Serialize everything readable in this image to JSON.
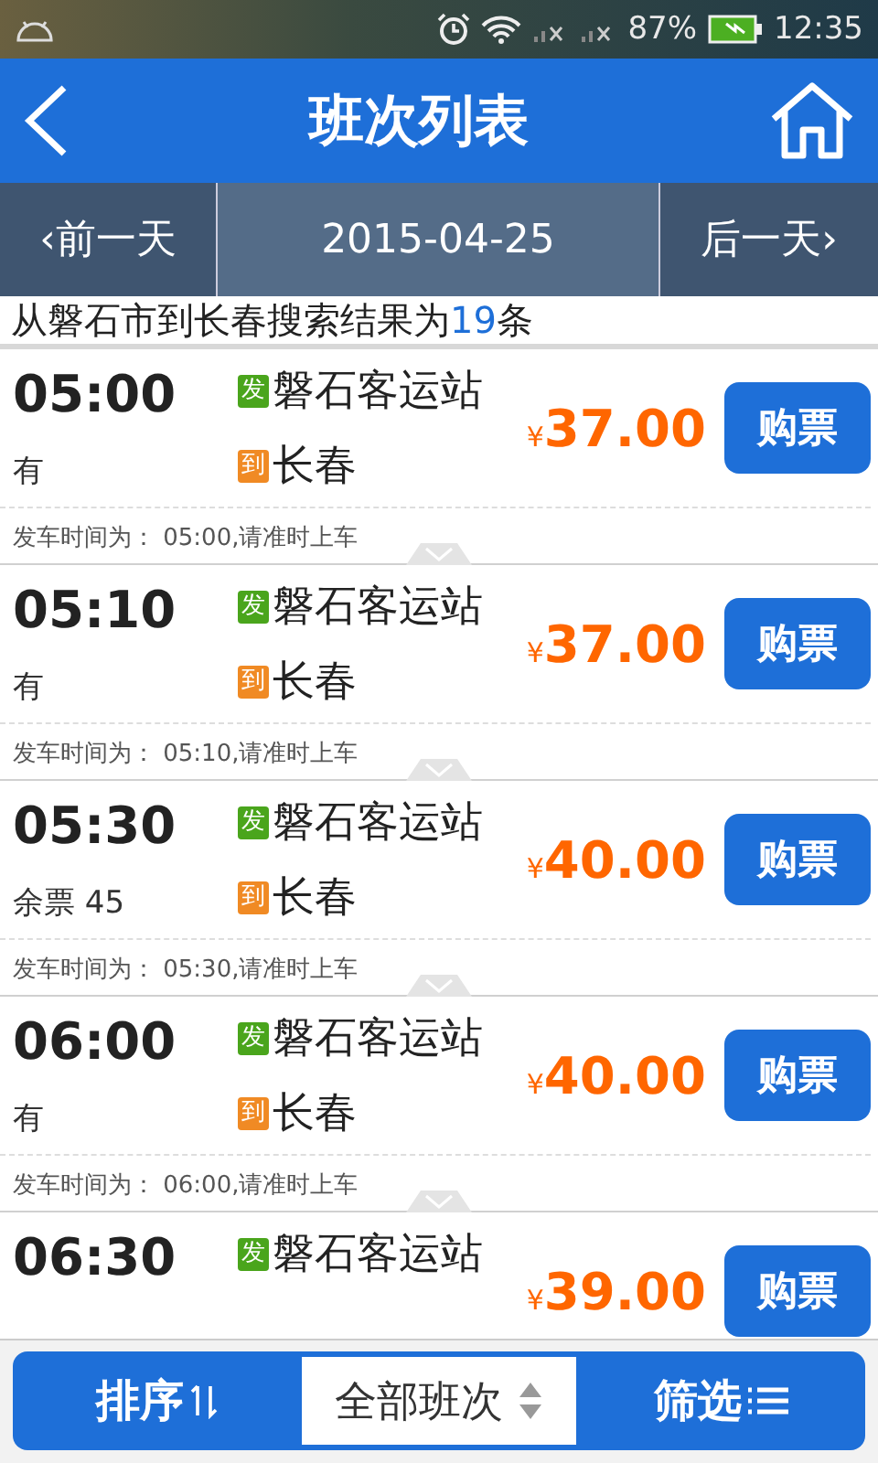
{
  "status_bar": {
    "battery_text": "87%",
    "time": "12:35"
  },
  "header": {
    "title": "班次列表"
  },
  "date_bar": {
    "prev": "‹前一天",
    "date": "2015-04-25",
    "next": "后一天›"
  },
  "summary": {
    "text": "从磐石市到长春搜索结果为",
    "count": "19",
    "suffix": "条"
  },
  "trips": [
    {
      "time": "05:00",
      "availability": "有",
      "from_badge": "发",
      "from": "磐石客运站",
      "to_badge": "到",
      "to": "长春",
      "currency": "¥",
      "price": "37.00",
      "button": "购票",
      "note": "发车时间为： 05:00,请准时上车"
    },
    {
      "time": "05:10",
      "availability": "有",
      "from_badge": "发",
      "from": "磐石客运站",
      "to_badge": "到",
      "to": "长春",
      "currency": "¥",
      "price": "37.00",
      "button": "购票",
      "note": "发车时间为： 05:10,请准时上车"
    },
    {
      "time": "05:30",
      "availability": "余票 45",
      "from_badge": "发",
      "from": "磐石客运站",
      "to_badge": "到",
      "to": "长春",
      "currency": "¥",
      "price": "40.00",
      "button": "购票",
      "note": "发车时间为： 05:30,请准时上车"
    },
    {
      "time": "06:00",
      "availability": "有",
      "from_badge": "发",
      "from": "磐石客运站",
      "to_badge": "到",
      "to": "长春",
      "currency": "¥",
      "price": "40.00",
      "button": "购票",
      "note": "发车时间为： 06:00,请准时上车"
    },
    {
      "time": "06:30",
      "from_badge": "发",
      "from": "磐石客运站",
      "currency": "¥",
      "price": "39.00",
      "button": "购票"
    }
  ],
  "bottom_bar": {
    "sort": "排序",
    "filter_select": "全部班次",
    "filter": "筛选"
  }
}
